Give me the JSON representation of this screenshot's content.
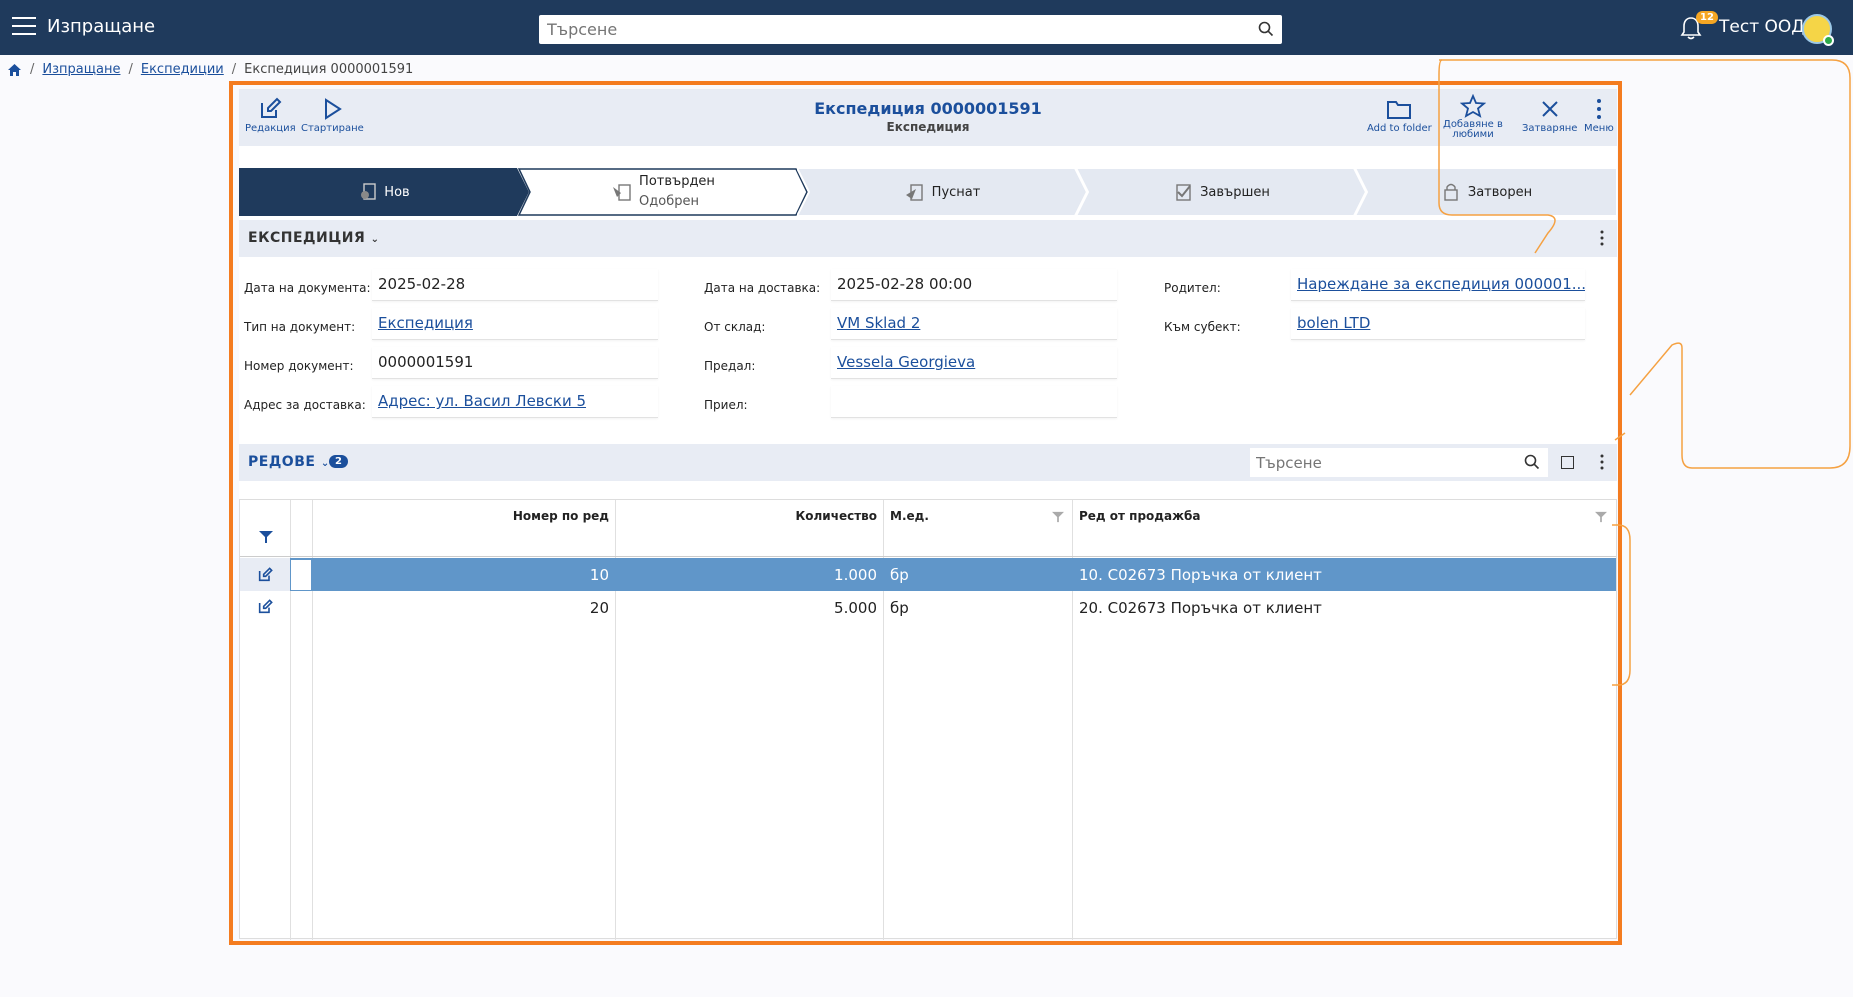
{
  "header": {
    "app_title": "Изпращане",
    "search_placeholder": "Търсене",
    "notification_count": "12",
    "company": "Тест ООД"
  },
  "breadcrumb": {
    "items": [
      "Изпращане",
      "Експедиции"
    ],
    "current": "Експедиция 0000001591"
  },
  "toolbar": {
    "edit_label": "Редакция",
    "start_label": "Стартиране",
    "title": "Експедиция 0000001591",
    "subtitle": "Експедиция",
    "folder_label": "Add to folder",
    "favorites_label_1": "Добавяне в",
    "favorites_label_2": "любими",
    "close_label": "Затваряне",
    "menu_label": "Меню"
  },
  "status_steps": [
    {
      "label": "Нов"
    },
    {
      "label": "Потвърден",
      "sublabel": "Одобрен"
    },
    {
      "label": "Пуснат"
    },
    {
      "label": "Завършен"
    },
    {
      "label": "Затворен"
    }
  ],
  "section_expedition": {
    "title": "ЕКСПЕДИЦИЯ",
    "fields": {
      "doc_date_label": "Дата на документа:",
      "doc_date": "2025-02-28",
      "doc_type_label": "Тип на документ:",
      "doc_type": "Експедиция",
      "doc_number_label": "Номер документ:",
      "doc_number": "0000001591",
      "delivery_address_label": "Адрес за доставка:",
      "delivery_address": "Адрес: ул. Васил Левски 5",
      "delivery_date_label": "Дата на доставка:",
      "delivery_date": "2025-02-28 00:00",
      "from_store_label": "От склад:",
      "from_store": "VM Sklad 2",
      "handed_by_label": "Предал:",
      "handed_by": "Vessela Georgieva",
      "received_by_label": "Приел:",
      "received_by": "",
      "parent_label": "Родител:",
      "parent": "Нареждане за експедиция 000001...",
      "to_party_label": "Към субект:",
      "to_party": "bolen LTD"
    }
  },
  "section_lines": {
    "title": "РЕДОВЕ",
    "count": "2",
    "search_placeholder": "Търсене",
    "columns": {
      "line_no": "Номер по ред",
      "qty": "Количество",
      "uom": "М.ед.",
      "sales_line": "Ред от продажба"
    },
    "rows": [
      {
        "line_no": "10",
        "qty": "1.000",
        "uom": "бр",
        "sales_line": "10. C02673 Поръчка от клиент"
      },
      {
        "line_no": "20",
        "qty": "5.000",
        "uom": "бр",
        "sales_line": "20. C02673 Поръчка от клиент"
      }
    ]
  },
  "colors": {
    "topbar": "#1f3a5c",
    "accent": "#1b4f9c",
    "highlight_border": "#f47c20",
    "selected_row": "#6096c9"
  }
}
